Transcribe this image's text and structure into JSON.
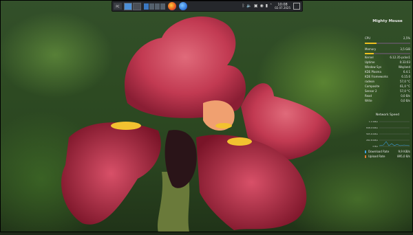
{
  "panel": {
    "launcher_label": "PC",
    "clock_time": "10:08",
    "clock_date": "02.07.2025",
    "tray_icons": [
      "bluetooth-icon",
      "volume-icon",
      "clipboard-icon",
      "network-icon",
      "battery-icon",
      "chevron-up-icon"
    ]
  },
  "widget": {
    "title": "Mighty Mouse",
    "cpu": {
      "label": "CPU",
      "value": "2,5%",
      "fraction": 0.25
    },
    "memory": {
      "label": "Memory",
      "value": "3,5 GiB",
      "fraction": 0.2
    },
    "info_rows": [
      {
        "label": "Kernel",
        "value": "6.12.35-pclos1"
      },
      {
        "label": "Uptime",
        "value": "0:33:03"
      },
      {
        "label": "Window Sys",
        "value": "Wayland"
      },
      {
        "label": "KDE Plasma",
        "value": "6.4.1"
      },
      {
        "label": "KDE Frameworks",
        "value": "6.15.0"
      },
      {
        "label": "radeon",
        "value": "57,0 °C"
      },
      {
        "label": "Composite",
        "value": "61,0 °C"
      },
      {
        "label": "Sensor 2",
        "value": "57,0 °C"
      },
      {
        "label": "Read",
        "value": "0,0 B/s"
      },
      {
        "label": "Write",
        "value": "0,0 B/s"
      }
    ],
    "network_title": "Network Speed",
    "graph_labels": [
      "1.1 KiB/s",
      "848,0 KiB/s",
      "565,6 KiB/s",
      "282,8 KiB/s",
      "0 B/s"
    ],
    "download": {
      "label": "Download Rate",
      "value": "9,9 KiB/s",
      "color": "#3fa0e0"
    },
    "upload": {
      "label": "Upload Rate",
      "value": "895,0 B/s",
      "color": "#e07a30"
    }
  }
}
